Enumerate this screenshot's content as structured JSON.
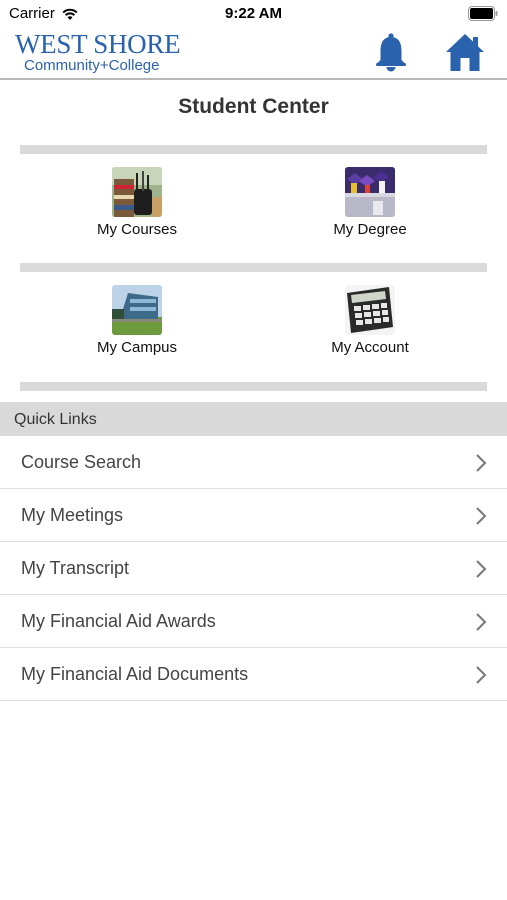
{
  "status_bar": {
    "carrier": "Carrier",
    "time": "9:22 AM"
  },
  "header": {
    "logo_line1": "WEST SHORE",
    "logo_line2": "Community+College",
    "brand_color": "#2a62ae",
    "icons": [
      "bell-icon",
      "home-icon"
    ]
  },
  "page": {
    "title": "Student Center"
  },
  "tiles": [
    {
      "label": "My Courses",
      "icon": "courses-photo"
    },
    {
      "label": "My Degree",
      "icon": "degree-photo"
    },
    {
      "label": "My Campus",
      "icon": "campus-photo"
    },
    {
      "label": "My Account",
      "icon": "account-photo"
    }
  ],
  "quick_links": {
    "header": "Quick Links",
    "items": [
      "Course Search",
      "My Meetings",
      "My Transcript",
      "My Financial Aid Awards",
      "My Financial Aid Documents"
    ]
  }
}
